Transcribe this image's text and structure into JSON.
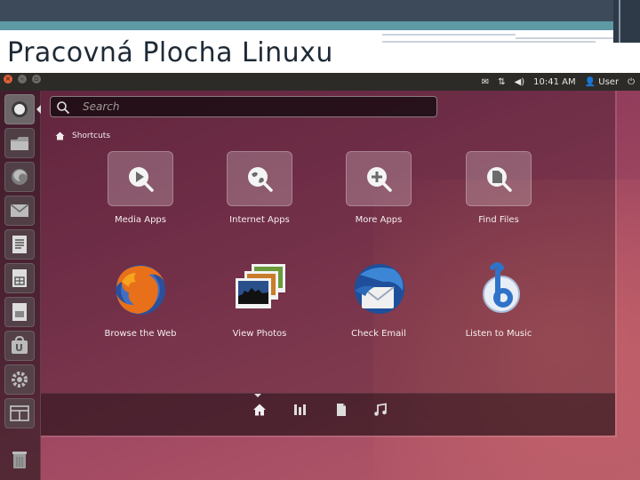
{
  "slide": {
    "title": "Pracovná Plocha Linuxu"
  },
  "panel": {
    "time": "10:41 AM",
    "user": "User"
  },
  "search": {
    "placeholder": "Search"
  },
  "shortcuts": {
    "label": "Shortcuts"
  },
  "apps": [
    {
      "label": "Media Apps",
      "icon": "media-apps-icon"
    },
    {
      "label": "Internet Apps",
      "icon": "internet-apps-icon"
    },
    {
      "label": "More Apps",
      "icon": "more-apps-icon"
    },
    {
      "label": "Find Files",
      "icon": "find-files-icon"
    },
    {
      "label": "Browse the Web",
      "icon": "firefox-icon"
    },
    {
      "label": "View Photos",
      "icon": "photos-icon"
    },
    {
      "label": "Check Email",
      "icon": "thunderbird-icon"
    },
    {
      "label": "Listen to Music",
      "icon": "banshee-icon"
    }
  ],
  "launcher": [
    "ubuntu-logo-icon",
    "home-folder-icon",
    "firefox-icon",
    "evolution-icon",
    "writer-icon",
    "calc-icon",
    "impress-icon",
    "software-center-icon",
    "settings-icon",
    "workspaces-icon",
    "trash-icon"
  ],
  "lenses": [
    "home-lens-icon",
    "applications-lens-icon",
    "files-lens-icon",
    "music-lens-icon"
  ],
  "colors": {
    "panel": "#2c2b28",
    "wallpaper": "#8f3b5a",
    "accent": "#e0613a"
  }
}
